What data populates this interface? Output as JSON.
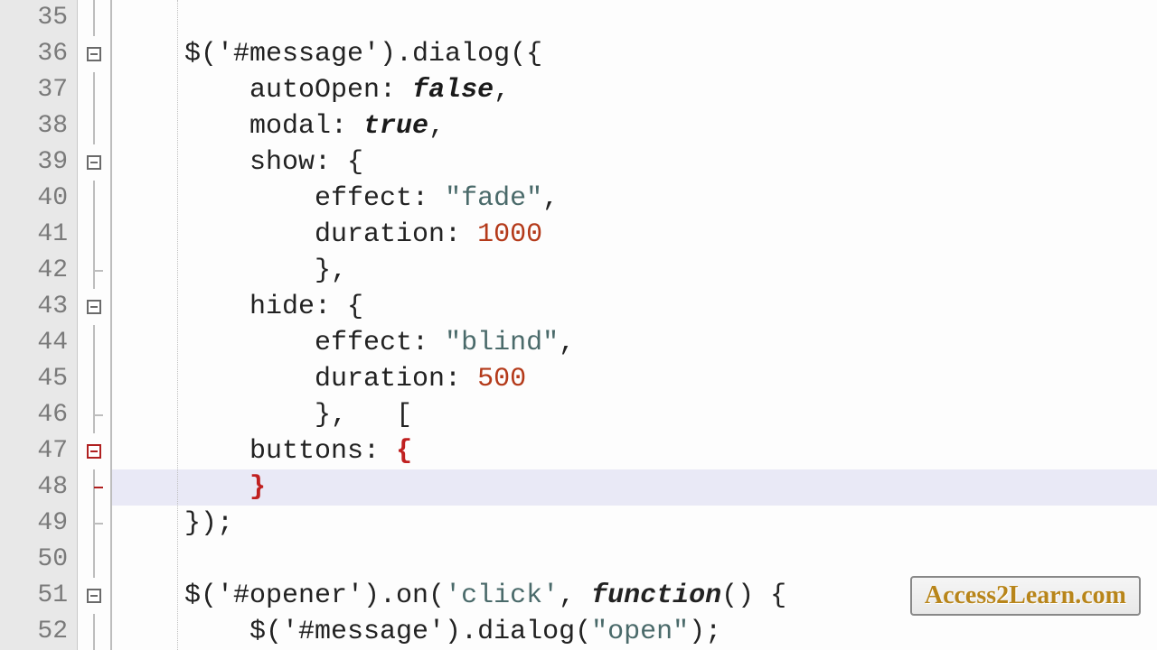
{
  "watermark": "Access2Learn.com",
  "lines": [
    {
      "num": "35",
      "fold": "line",
      "code_html": ""
    },
    {
      "num": "36",
      "fold": "minus",
      "code_html": "    $('#message').dialog({"
    },
    {
      "num": "37",
      "fold": "line",
      "code_html": "        autoOpen: <span class=\"kw-false\">false</span>,"
    },
    {
      "num": "38",
      "fold": "line",
      "code_html": "        modal: <span class=\"kw-true\">true</span>,"
    },
    {
      "num": "39",
      "fold": "minus",
      "code_html": "        show: {"
    },
    {
      "num": "40",
      "fold": "line",
      "code_html": "            effect: <span class=\"str\">\"fade\"</span>,"
    },
    {
      "num": "41",
      "fold": "line",
      "code_html": "            duration: <span class=\"num\">1000</span>"
    },
    {
      "num": "42",
      "fold": "tick",
      "code_html": "            },"
    },
    {
      "num": "43",
      "fold": "minus",
      "code_html": "        hide: {"
    },
    {
      "num": "44",
      "fold": "line",
      "code_html": "            effect: <span class=\"str\">\"blind\"</span>,"
    },
    {
      "num": "45",
      "fold": "line",
      "code_html": "            duration: <span class=\"num\">500</span>"
    },
    {
      "num": "46",
      "fold": "tick",
      "code_html": "            },   <span style=\"letter-spacing:-4px\">[</span>"
    },
    {
      "num": "47",
      "fold": "minus-red",
      "code_html": "        buttons: <span class=\"brace-match\">{</span>"
    },
    {
      "num": "48",
      "fold": "tick-red",
      "hl": true,
      "code_html": "        <span class=\"brace-match\">}</span>"
    },
    {
      "num": "49",
      "fold": "tick",
      "code_html": "    });"
    },
    {
      "num": "50",
      "fold": "line",
      "code_html": ""
    },
    {
      "num": "51",
      "fold": "minus",
      "code_html": "    $('#opener').on(<span class=\"str\">'click'</span>, <span class=\"func-kw\">function</span>() {"
    },
    {
      "num": "52",
      "fold": "line",
      "code_html": "        $('#message').dialog(<span class=\"str\">\"open\"</span>);"
    }
  ]
}
